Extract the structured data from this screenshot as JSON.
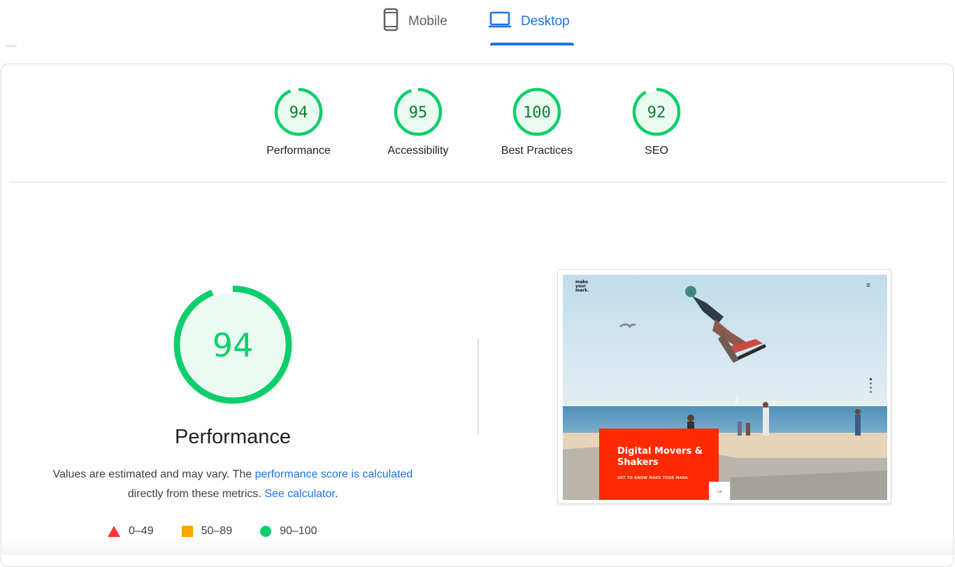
{
  "tabs": {
    "mobile": {
      "label": "Mobile",
      "icon": "smartphone-icon"
    },
    "desktop": {
      "label": "Desktop",
      "icon": "laptop-icon",
      "selected": true
    }
  },
  "categories": [
    {
      "label": "Performance",
      "score": "94",
      "fraction": 0.94
    },
    {
      "label": "Accessibility",
      "score": "95",
      "fraction": 0.95
    },
    {
      "label": "Best Practices",
      "score": "100",
      "fraction": 1.0
    },
    {
      "label": "SEO",
      "score": "92",
      "fraction": 0.92
    }
  ],
  "performance": {
    "score": "94",
    "fraction": 0.94,
    "title": "Performance",
    "desc_text_1": "Values are estimated and may vary. The ",
    "desc_link_1": "performance score is calculated",
    "desc_text_2": "directly from these metrics. ",
    "desc_link_2": "See calculator",
    "desc_text_3": "."
  },
  "legend": [
    {
      "shape": "triangle",
      "range": "0–49",
      "color": "#ff3333"
    },
    {
      "shape": "square",
      "range": "50–89",
      "color": "#ffa400"
    },
    {
      "shape": "circle",
      "range": "90–100",
      "color": "#0cce6b"
    }
  ],
  "screenshot": {
    "logo": "make your mark.",
    "menu_icon": "hamburger-menu-icon",
    "headline": "Digital Movers & Shakers",
    "subline": "GET TO KNOW MAKE YOUR MARK",
    "arrow_icon": "arrow-right-icon"
  },
  "colors": {
    "pass": "#0cce6b",
    "pass_text": "#0a7f2e",
    "pass_fill": "#eafbf1",
    "accent": "#1a73e8"
  }
}
